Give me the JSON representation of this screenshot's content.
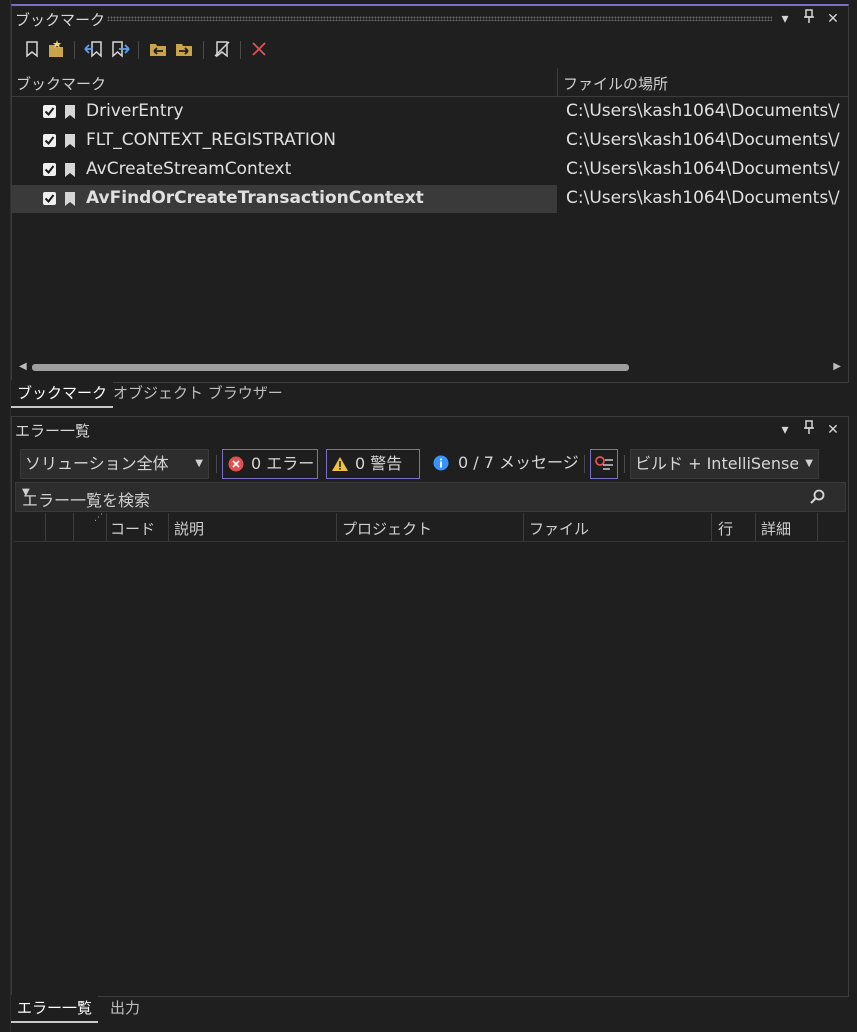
{
  "bookmarks_panel": {
    "title": "ブックマーク",
    "columns": {
      "name": "ブックマーク",
      "location": "ファイルの場所"
    },
    "rows": [
      {
        "name": "DriverEntry",
        "path": "C:\\Users\\kash1064\\Documents\\/",
        "checked": true,
        "selected": false
      },
      {
        "name": "FLT_CONTEXT_REGISTRATION",
        "path": "C:\\Users\\kash1064\\Documents\\/",
        "checked": true,
        "selected": false
      },
      {
        "name": "AvCreateStreamContext",
        "path": "C:\\Users\\kash1064\\Documents\\/",
        "checked": true,
        "selected": false
      },
      {
        "name": "AvFindOrCreateTransactionContext",
        "path": "C:\\Users\\kash1064\\Documents\\/",
        "checked": true,
        "selected": true
      }
    ],
    "tabs": [
      {
        "label": "ブックマーク",
        "active": true
      },
      {
        "label": "オブジェクト ブラウザー",
        "active": false
      }
    ]
  },
  "errorlist_panel": {
    "title": "エラー一覧",
    "scope_selected": "ソリューション全体",
    "errors_label": "0 エラー",
    "warnings_label": "0 警告",
    "messages_label": "0 / 7 メッセージ",
    "source_selected": "ビルド + IntelliSense",
    "search_placeholder": "エラー一覧を検索",
    "columns": {
      "code": "コード",
      "description": "説明",
      "project": "プロジェクト",
      "file": "ファイル",
      "line": "行",
      "detail": "詳細"
    },
    "tabs": [
      {
        "label": "エラー一覧",
        "active": true
      },
      {
        "label": "出力",
        "active": false
      }
    ]
  },
  "titlebar_buttons": {
    "dropdown": "▾",
    "pin": "📌",
    "close": "✕"
  },
  "colors": {
    "background": "#1f1f1f",
    "accent": "#7a70c7",
    "error": "#e05252",
    "warning": "#f0c040",
    "info": "#3794ff",
    "selection": "#3a3a3a"
  }
}
